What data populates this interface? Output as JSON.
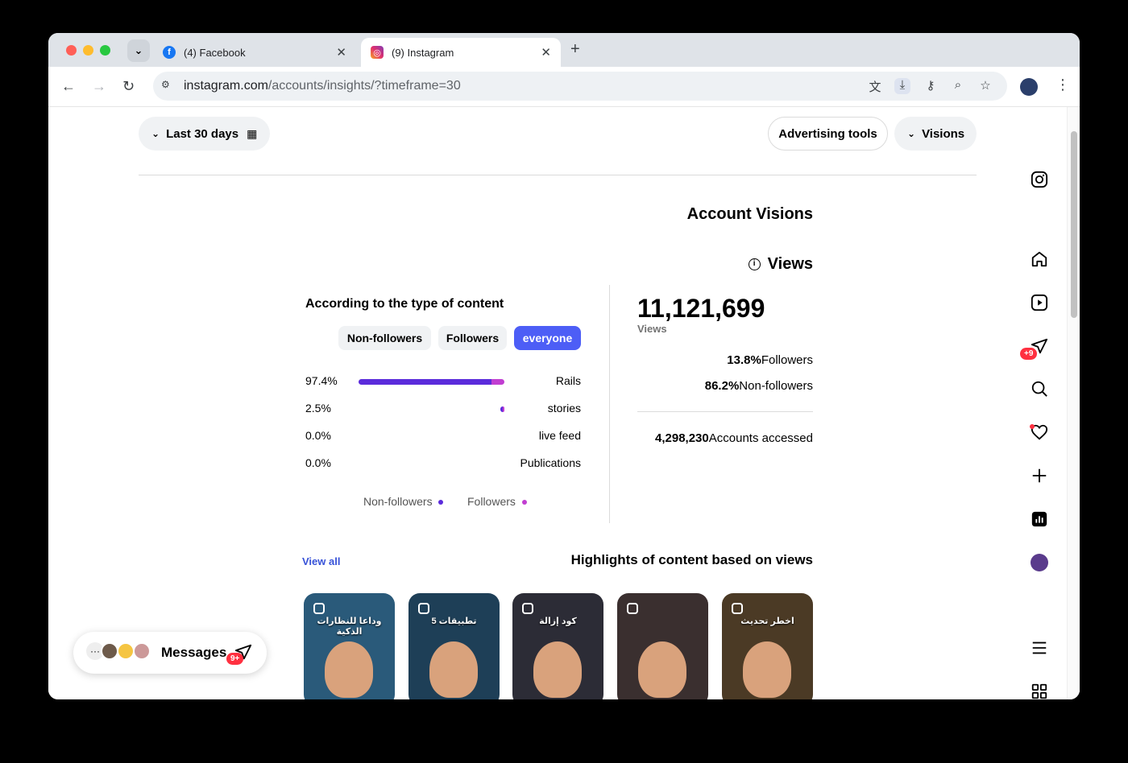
{
  "browser": {
    "tabs": [
      {
        "title": "(4) Facebook",
        "icon": "facebook-icon"
      },
      {
        "title": "(9) Instagram",
        "icon": "instagram-icon"
      }
    ],
    "url_host": "instagram.com",
    "url_path": "/accounts/insights/?timeframe=30"
  },
  "filters": {
    "timeframe": "Last 30 days",
    "advertising": "Advertising tools",
    "visions": "Visions"
  },
  "account": {
    "title": "Account Visions",
    "views_heading": "Views"
  },
  "content_type": {
    "title": "According to the type of content",
    "segments": [
      "Non-followers",
      "Followers",
      "everyone"
    ],
    "active_segment": "everyone",
    "rows": [
      {
        "pct": "97.4%",
        "label": "Rails",
        "value": 97.4,
        "followers_share": 0.09
      },
      {
        "pct": "2.5%",
        "label": "stories",
        "value": 2.5,
        "followers_share": 0.5
      },
      {
        "pct": "0.0%",
        "label": "live feed",
        "value": 0.0,
        "followers_share": 0
      },
      {
        "pct": "0.0%",
        "label": "Publications",
        "value": 0.0,
        "followers_share": 0
      }
    ],
    "legend": [
      "Non-followers",
      "Followers"
    ],
    "colors": {
      "non_followers": "#5b2bdb",
      "followers": "#c13ed1",
      "accent": "#4d5ef6"
    }
  },
  "totals": {
    "views": "11,121,699",
    "views_label": "Views",
    "followers_pct": "13.8%",
    "followers_label": "Followers",
    "non_followers_pct": "86.2%",
    "non_followers_label": "Non-followers",
    "accounts": "4,298,230",
    "accounts_label": "Accounts accessed"
  },
  "highlights": {
    "view_all": "View all",
    "title": "Highlights of content based on views",
    "thumbs": [
      {
        "caption": "وداعا للنظارات الذكية",
        "bg": "#2a5a7a"
      },
      {
        "caption": "5 تطبيقات",
        "bg": "#1e3f57"
      },
      {
        "caption": "كود إزالة",
        "bg": "#2c2c36"
      },
      {
        "caption": "",
        "bg": "#3a2f2f"
      },
      {
        "caption": "اخطر تحديث",
        "bg": "#4b3a25"
      }
    ]
  },
  "messages": {
    "label": "Messages",
    "badge": "9+"
  },
  "sidebar": {
    "messages_badge": "+9"
  }
}
